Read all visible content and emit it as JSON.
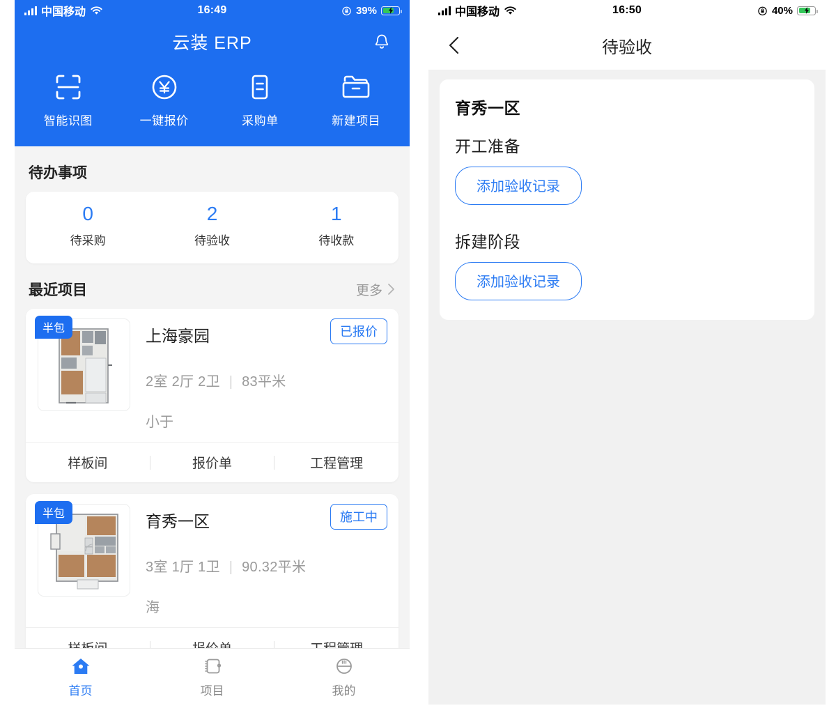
{
  "theme": {
    "brand_blue": "#1d6ef0",
    "accent_blue": "#2b7bf3",
    "battery_green": "#34c759",
    "page_bg": "#f4f4f4",
    "muted_text": "#9a9a9a"
  },
  "left_phone": {
    "status_bar": {
      "carrier": "中国移动",
      "time": "16:49",
      "battery_percent": "39%",
      "signal_icon": "signal-bars-icon",
      "wifi_icon": "wifi-icon",
      "lock_icon": "rotation-lock-icon",
      "battery_icon": "battery-charging-icon"
    },
    "header": {
      "app_title": "云装 ERP",
      "bell_icon": "bell-icon"
    },
    "quick_actions": [
      {
        "label": "智能识图",
        "icon": "scan-frame-icon"
      },
      {
        "label": "一键报价",
        "icon": "yen-circle-icon"
      },
      {
        "label": "采购单",
        "icon": "document-list-icon"
      },
      {
        "label": "新建项目",
        "icon": "folder-icon"
      }
    ],
    "todo": {
      "title": "待办事项",
      "items": [
        {
          "count": "0",
          "label": "待采购"
        },
        {
          "count": "2",
          "label": "待验收"
        },
        {
          "count": "1",
          "label": "待收款"
        }
      ]
    },
    "recent": {
      "title": "最近项目",
      "more_label": "更多",
      "more_icon": "chevron-right-icon",
      "projects": [
        {
          "badge": "半包",
          "name": "上海豪园",
          "status": "已报价",
          "rooms": "2室 2厅 2卫",
          "separator": "|",
          "area": "83平米",
          "owner": "小于",
          "thumb_icon": "floorplan-thumbnail",
          "actions": [
            "样板间",
            "报价单",
            "工程管理"
          ]
        },
        {
          "badge": "半包",
          "name": "育秀一区",
          "status": "施工中",
          "rooms": "3室 1厅 1卫",
          "separator": "|",
          "area": "90.32平米",
          "owner": "海",
          "thumb_icon": "floorplan-thumbnail",
          "actions": [
            "样板间",
            "报价单",
            "工程管理"
          ]
        }
      ]
    },
    "tabbar": [
      {
        "label": "首页",
        "icon": "home-icon",
        "active": true
      },
      {
        "label": "项目",
        "icon": "notebook-icon",
        "active": false
      },
      {
        "label": "我的",
        "icon": "person-icon",
        "active": false
      }
    ]
  },
  "right_phone": {
    "status_bar": {
      "carrier": "中国移动",
      "time": "16:50",
      "battery_percent": "40%",
      "signal_icon": "signal-bars-icon",
      "wifi_icon": "wifi-icon",
      "lock_icon": "rotation-lock-icon",
      "battery_icon": "battery-charging-icon"
    },
    "nav": {
      "title": "待验收",
      "back_icon": "chevron-left-icon"
    },
    "card": {
      "project_name": "育秀一区",
      "stages": [
        {
          "name": "开工准备",
          "button_label": "添加验收记录"
        },
        {
          "name": "拆建阶段",
          "button_label": "添加验收记录"
        }
      ]
    }
  }
}
